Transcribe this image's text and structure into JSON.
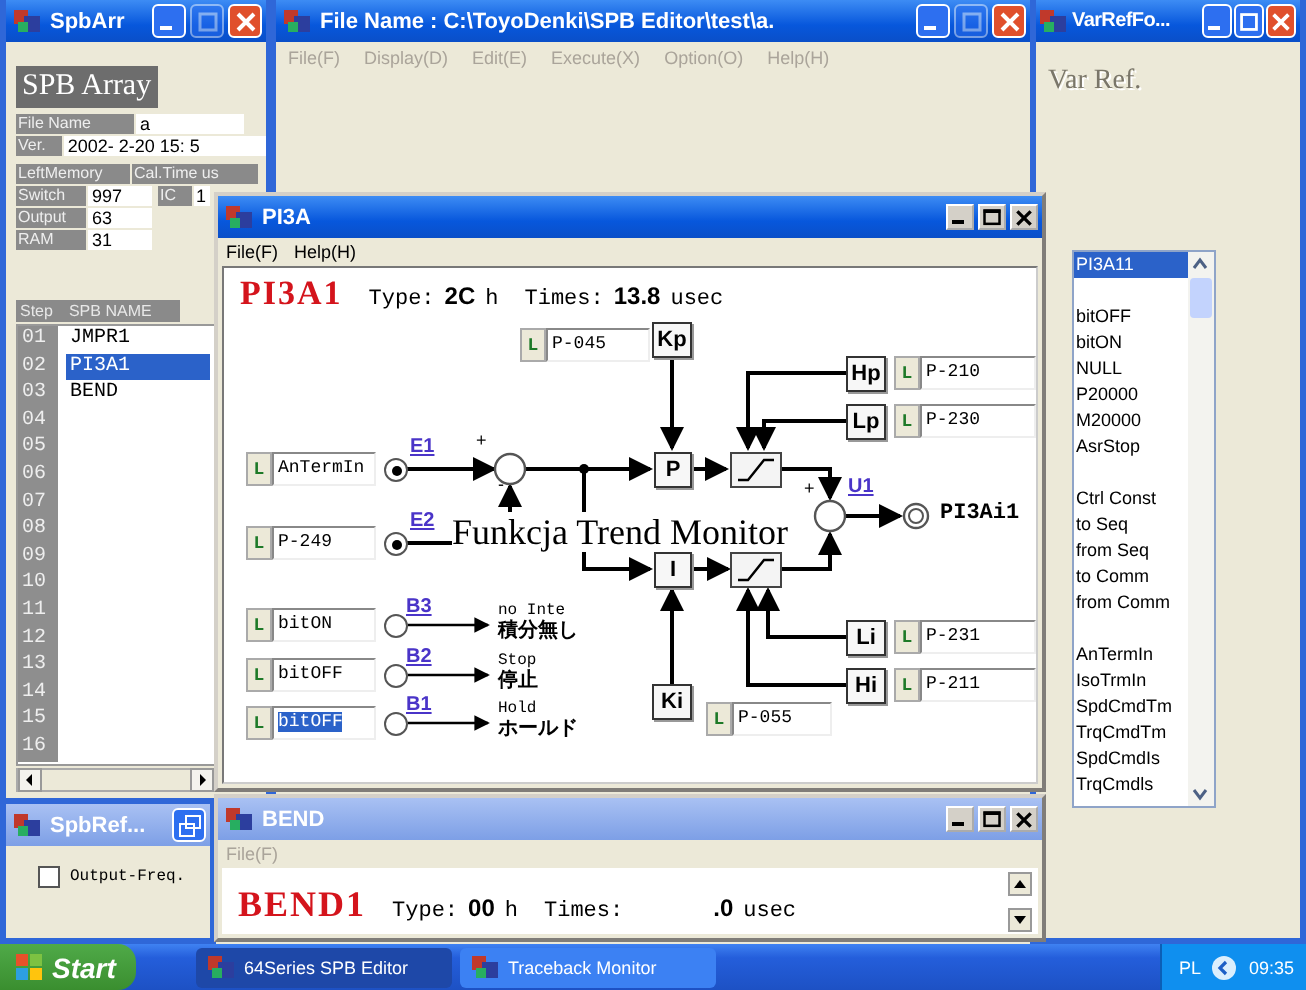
{
  "spb_array": {
    "title": "SpbArr",
    "heading": "SPB Array",
    "file_name_label": "File Name",
    "file_name": "a",
    "ver_label": "Ver.",
    "ver": "2002- 2-20 15: 5",
    "left_memory_label": "LeftMemory",
    "cal_time_label": "Cal.Time us",
    "stats": [
      {
        "label": "Switch",
        "value": "997"
      },
      {
        "label": "Output",
        "value": "63"
      },
      {
        "label": "RAM",
        "value": "31"
      }
    ],
    "ic_label": "IC",
    "ic_value": "1",
    "columns": [
      "Step",
      "SPB NAME"
    ],
    "steps": [
      {
        "step": "01",
        "name": "JMPR1",
        "selected": false
      },
      {
        "step": "02",
        "name": "PI3A1",
        "selected": true
      },
      {
        "step": "03",
        "name": "BEND",
        "selected": false
      },
      {
        "step": "04",
        "selected": false
      },
      {
        "step": "05",
        "selected": false
      },
      {
        "step": "06",
        "selected": false
      },
      {
        "step": "07",
        "selected": false
      },
      {
        "step": "08",
        "selected": false
      },
      {
        "step": "09",
        "selected": false
      },
      {
        "step": "10",
        "selected": false
      },
      {
        "step": "11",
        "selected": false
      },
      {
        "step": "12",
        "selected": false
      },
      {
        "step": "13",
        "selected": false
      },
      {
        "step": "14",
        "selected": false
      },
      {
        "step": "15",
        "selected": false
      },
      {
        "step": "16",
        "selected": false
      }
    ]
  },
  "file_window": {
    "title": "File Name : C:\\ToyoDenki\\SPB Editor\\test\\a.",
    "menu": [
      {
        "label": "File(F)",
        "disabled": true
      },
      {
        "label": "Display(D)",
        "disabled": true
      },
      {
        "label": "Edit(E)",
        "disabled": true
      },
      {
        "label": "Execute(X)",
        "disabled": true
      },
      {
        "label": "Option(O)",
        "disabled": true
      },
      {
        "label": "Help(H)",
        "disabled": true
      }
    ]
  },
  "var_ref": {
    "title": "VarRefFo...",
    "heading": "Var Ref.",
    "groups": [
      [
        {
          "label": "PI3A11",
          "selected": true
        }
      ],
      [
        {
          "label": "bitOFF",
          "selected": false
        },
        {
          "label": "bitON",
          "selected": false
        },
        {
          "label": "NULL",
          "selected": false
        },
        {
          "label": "P20000",
          "selected": false
        },
        {
          "label": "M20000",
          "selected": false
        },
        {
          "label": "AsrStop",
          "selected": false
        }
      ],
      [
        {
          "label": "Ctrl Const",
          "selected": false
        },
        {
          "label": "to Seq",
          "selected": false
        },
        {
          "label": "from Seq",
          "selected": false
        },
        {
          "label": "to Comm",
          "selected": false
        },
        {
          "label": "from Comm",
          "selected": false
        }
      ],
      [
        {
          "label": "AnTermIn",
          "selected": false
        },
        {
          "label": "IsoTrmIn",
          "selected": false
        },
        {
          "label": "SpdCmdTm",
          "selected": false
        },
        {
          "label": "TrqCmdTm",
          "selected": false
        },
        {
          "label": "SpdCmdIs",
          "selected": false
        },
        {
          "label": "TrqCmdls",
          "selected": false
        }
      ]
    ]
  },
  "pi3a": {
    "title": "PI3A",
    "menu": [
      {
        "label": "File(F)",
        "disabled": false
      },
      {
        "label": "Help(H)",
        "disabled": false
      }
    ],
    "block": "PI3A1",
    "type_label": "Type:",
    "type_value": "2C",
    "type_unit": "h",
    "times_label": "Times:",
    "times_value": "13.8",
    "times_unit": "usec",
    "inputs": [
      {
        "link": "L",
        "value": "AnTermIn",
        "signal": "E1",
        "on": true,
        "selected": false
      },
      {
        "link": "L",
        "value": "P-249",
        "signal": "E2",
        "on": true,
        "selected": false
      }
    ],
    "bits": [
      {
        "link": "L",
        "value": "bitON",
        "signal": "B3",
        "on": false,
        "desc": "no Inte",
        "desc_jp": "積分無し",
        "selected": false
      },
      {
        "link": "L",
        "value": "bitOFF",
        "signal": "B2",
        "on": false,
        "desc": "Stop",
        "desc_jp": "停止",
        "selected": false
      },
      {
        "link": "L",
        "value": "bitOFF",
        "signal": "B1",
        "on": false,
        "desc": "Hold",
        "desc_jp": "ホールド",
        "selected": true
      }
    ],
    "params": [
      {
        "name": "Kp",
        "link": "L",
        "value": "P-045"
      },
      {
        "name": "Hp",
        "link": "L",
        "value": "P-210"
      },
      {
        "name": "Lp",
        "link": "L",
        "value": "P-230"
      },
      {
        "name": "Li",
        "link": "L",
        "value": "P-231"
      },
      {
        "name": "Hi",
        "link": "L",
        "value": "P-211"
      },
      {
        "name": "Ki",
        "link": "L",
        "value": "P-055"
      }
    ],
    "blocks": [
      "P",
      "I"
    ],
    "signs": [
      "+",
      "-",
      "+"
    ],
    "output_signal": "U1",
    "output": "PI3Ai1"
  },
  "bend": {
    "title": "BEND",
    "menu": [
      {
        "label": "File(F)",
        "disabled": true
      }
    ],
    "block": "BEND1",
    "type_label": "Type:",
    "type_value": "00",
    "type_unit": "h",
    "times_label": "Times:",
    "times_value": ".0",
    "times_unit": "usec"
  },
  "spb_ref": {
    "title": "SpbRef...",
    "option": {
      "label": "Output-Freq.",
      "checked": false
    }
  },
  "caption": "Funkcja Trend Monitor",
  "taskbar": {
    "start": "Start",
    "tasks": [
      {
        "label": "64Series SPB Editor",
        "selected": true
      },
      {
        "label": "Traceback Monitor",
        "selected": false
      }
    ],
    "language": "PL",
    "clock": "09:35"
  }
}
